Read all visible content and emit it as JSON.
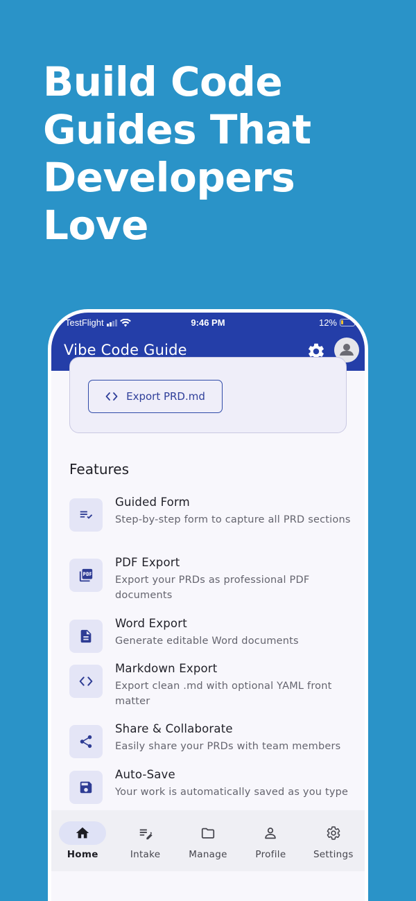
{
  "hero": {
    "headline": "Build Code Guides That Developers Love"
  },
  "status_bar": {
    "carrier": "TestFlight",
    "time": "9:46 PM",
    "battery": "12%"
  },
  "app_bar": {
    "title": "Vibe Code Guide"
  },
  "export": {
    "button_label": "Export PRD.md"
  },
  "features": {
    "title": "Features",
    "items": [
      {
        "title": "Guided Form",
        "desc": "Step-by-step form to capture all PRD sections",
        "icon": "edit-note-icon"
      },
      {
        "title": "PDF Export",
        "desc": "Export your PRDs as professional PDF documents",
        "icon": "pdf-icon"
      },
      {
        "title": "Word Export",
        "desc": "Generate editable Word documents",
        "icon": "document-icon"
      },
      {
        "title": "Markdown Export",
        "desc": "Export clean .md with optional YAML front matter",
        "icon": "code-icon"
      },
      {
        "title": "Share & Collaborate",
        "desc": "Easily share your PRDs with team members",
        "icon": "share-icon"
      },
      {
        "title": "Auto-Save",
        "desc": "Your work is automatically saved as you type",
        "icon": "save-icon"
      }
    ]
  },
  "bottom_nav": {
    "items": [
      {
        "label": "Home",
        "icon": "home-icon",
        "active": true
      },
      {
        "label": "Intake",
        "icon": "edit-note-icon"
      },
      {
        "label": "Manage",
        "icon": "folder-icon"
      },
      {
        "label": "Profile",
        "icon": "person-icon"
      },
      {
        "label": "Settings",
        "icon": "settings-icon"
      }
    ]
  },
  "colors": {
    "background": "#2a93c8",
    "app_bar": "#243ea8",
    "accent": "#2f4aa8"
  }
}
